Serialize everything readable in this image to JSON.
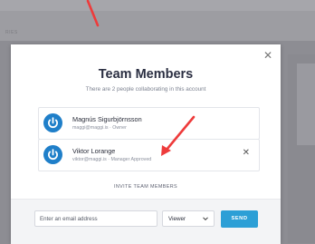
{
  "background": {
    "faint_text": "RIES"
  },
  "modal": {
    "title": "Team Members",
    "subtitle": "There are 2 people collaborating in this account",
    "close_icon": "close-icon"
  },
  "members": [
    {
      "name": "Magnús Sigurbjörnsson",
      "detail": "maggi@maggi.is · Owner",
      "avatar_icon": "power-icon",
      "removable": false
    },
    {
      "name": "Viktor Lorange",
      "detail": "viktor@maggi.is · Manager Approved",
      "avatar_icon": "power-icon",
      "removable": true
    }
  ],
  "invite": {
    "label": "INVITE TEAM MEMBERS",
    "email_placeholder": "Enter an email address",
    "role_value": "Viewer",
    "send_label": "SEND"
  },
  "colors": {
    "accent": "#2c9fd6",
    "avatar": "#1f7fc9",
    "annotation_arrow": "#ee3b3b",
    "title": "#2b2f42"
  }
}
